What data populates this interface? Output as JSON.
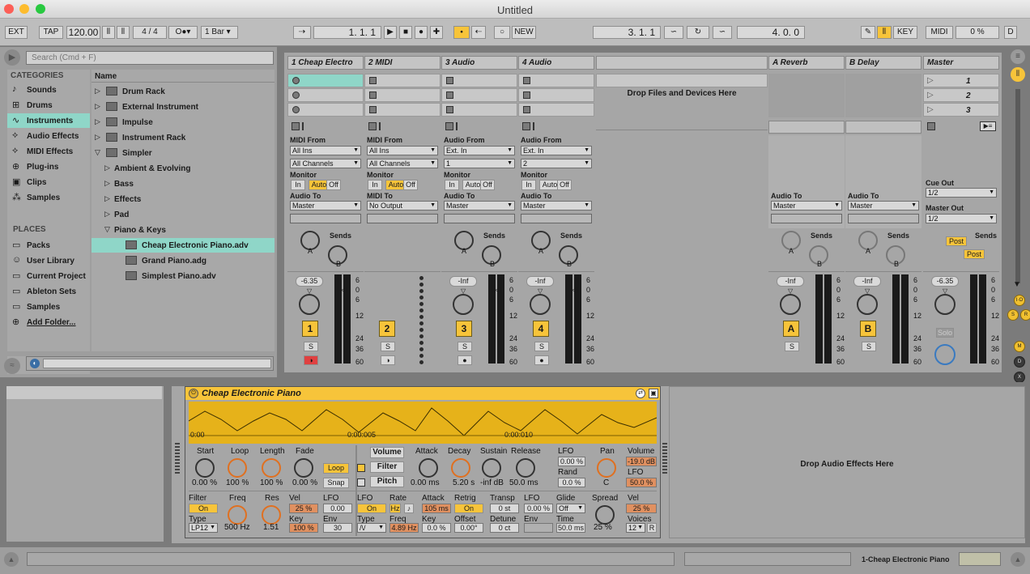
{
  "window": {
    "title": "Untitled"
  },
  "control_bar": {
    "ext": "EXT",
    "tap": "TAP",
    "tempo": "120.00",
    "sig_num": "4",
    "sig_den": "4",
    "quantize": "1 Bar",
    "position": "1.    1.    1",
    "new": "NEW",
    "loop_start": "3.    1.    1",
    "loop_length": "4.    0.    0",
    "key": "KEY",
    "midi": "MIDI",
    "cpu": "0 %",
    "d": "D"
  },
  "browser": {
    "search_placeholder": "Search (Cmd + F)",
    "categories_heading": "CATEGORIES",
    "categories": [
      "Sounds",
      "Drums",
      "Instruments",
      "Audio Effects",
      "MIDI Effects",
      "Plug-ins",
      "Clips",
      "Samples"
    ],
    "places_heading": "PLACES",
    "places": [
      "Packs",
      "User Library",
      "Current Project",
      "Ableton Sets",
      "Samples",
      "Add Folder..."
    ],
    "name_header": "Name",
    "items": [
      "Drum Rack",
      "External Instrument",
      "Impulse",
      "Instrument Rack",
      "Simpler",
      "Ambient & Evolving",
      "Bass",
      "Effects",
      "Pad",
      "Piano & Keys",
      "Cheap Electronic Piano.adv",
      "Grand Piano.adg",
      "Simplest Piano.adv"
    ]
  },
  "session": {
    "tracks": [
      {
        "name": "1 Cheap Electro",
        "from_label": "MIDI From",
        "from": "All Ins",
        "channel": "All Channels",
        "monitor_label": "Monitor",
        "to_label": "Audio To",
        "to": "Master",
        "vol": "-6.35",
        "num": "1",
        "sends": "Sends"
      },
      {
        "name": "2 MIDI",
        "from_label": "MIDI From",
        "from": "All Ins",
        "channel": "All Channels",
        "monitor_label": "Monitor",
        "to_label": "MIDI To",
        "to": "No Output",
        "num": "2"
      },
      {
        "name": "3 Audio",
        "from_label": "Audio From",
        "from": "Ext. In",
        "channel": "1",
        "monitor_label": "Monitor",
        "to_label": "Audio To",
        "to": "Master",
        "vol": "-Inf",
        "num": "3",
        "sends": "Sends"
      },
      {
        "name": "4 Audio",
        "from_label": "Audio From",
        "from": "Ext. In",
        "channel": "2",
        "monitor_label": "Monitor",
        "to_label": "Audio To",
        "to": "Master",
        "vol": "-Inf",
        "num": "4",
        "sends": "Sends"
      }
    ],
    "monitor_opts": [
      "In",
      "Auto",
      "Off"
    ],
    "drop_text": "Drop Files and Devices Here",
    "returns": [
      {
        "name": "A Reverb",
        "to_label": "Audio To",
        "to": "Master",
        "vol": "-Inf",
        "num": "A",
        "sends": "Sends"
      },
      {
        "name": "B Delay",
        "to_label": "Audio To",
        "to": "Master",
        "vol": "-Inf",
        "num": "B",
        "sends": "Sends"
      }
    ],
    "master": {
      "name": "Master",
      "scenes": [
        "1",
        "2",
        "3"
      ],
      "cue_label": "Cue Out",
      "cue": "1/2",
      "out_label": "Master Out",
      "out": "1/2",
      "vol": "-6.35",
      "post": "Post",
      "solo": "Solo",
      "sends": "Sends"
    },
    "meter_scale": [
      "6",
      "0",
      "6",
      "12",
      "24",
      "36",
      "60"
    ],
    "s": "S"
  },
  "io_icons": [
    "I·O",
    "S",
    "R",
    "M",
    "D",
    "X"
  ],
  "device": {
    "title": "Cheap Electronic Piano",
    "t0": "0:00",
    "t1": "0:00:005",
    "t2": "0:00:010",
    "r1": {
      "start": "Start",
      "start_v": "0.00 %",
      "loop": "Loop",
      "loop_v": "100 %",
      "length": "Length",
      "length_v": "100 %",
      "fade": "Fade",
      "fade_v": "0.00 %",
      "loop_btn": "Loop",
      "snap": "Snap",
      "volume": "Volume",
      "filter": "Filter",
      "pitch": "Pitch",
      "attack": "Attack",
      "attack_v": "0.00 ms",
      "decay": "Decay",
      "decay_v": "5.20 s",
      "sustain": "Sustain",
      "sustain_v": "-inf dB",
      "release": "Release",
      "release_v": "50.0 ms",
      "lfo": "LFO",
      "lfo_v": "0.00 %",
      "rand": "Rand",
      "rand_v": "0.0 %",
      "pan": "Pan",
      "pan_v": "C",
      "vol": "Volume",
      "vol_v": "-19.0 dB",
      "vlfo": "LFO",
      "vlfo_v": "50.0 %"
    },
    "r2": {
      "filter": "Filter",
      "on": "On",
      "type": "Type",
      "type_v": "LP12",
      "freq": "Freq",
      "freq_v": "500 Hz",
      "res": "Res",
      "res_v": "1.51",
      "vel": "Vel",
      "vel_v": "25 %",
      "key": "Key",
      "key_v": "100 %",
      "lfo": "LFO",
      "lfo_v": "0.00",
      "env": "Env",
      "env_v": "30",
      "lfo2": "LFO",
      "on2": "On",
      "type2": "Type",
      "rate": "Rate",
      "hz": "Hz",
      "freq2": "Freq",
      "freq2_v": "4.89 Hz",
      "attack": "Attack",
      "attack_v": "105 ms",
      "akey": "Key",
      "akey_v": "0.0 %",
      "retrig": "Retrig",
      "on3": "On",
      "offset": "Offset",
      "offset_v": "0.00°",
      "transp": "Transp",
      "transp_v": "0 st",
      "detune": "Detune",
      "detune_v": "0 ct",
      "plfo": "LFO",
      "plfo_v": "0.00 %",
      "penv": "Env",
      "glide": "Glide",
      "glide_v": "Off",
      "time": "Time",
      "time_v": "50.0 ms",
      "spread": "Spread",
      "spread_v": "25 %",
      "vel2": "Vel",
      "vel2_v": "25 %",
      "voices": "Voices",
      "voices_v": "12",
      "r": "R"
    }
  },
  "drop_audio": "Drop Audio Effects Here",
  "status": {
    "track": "1-Cheap Electronic Piano"
  }
}
